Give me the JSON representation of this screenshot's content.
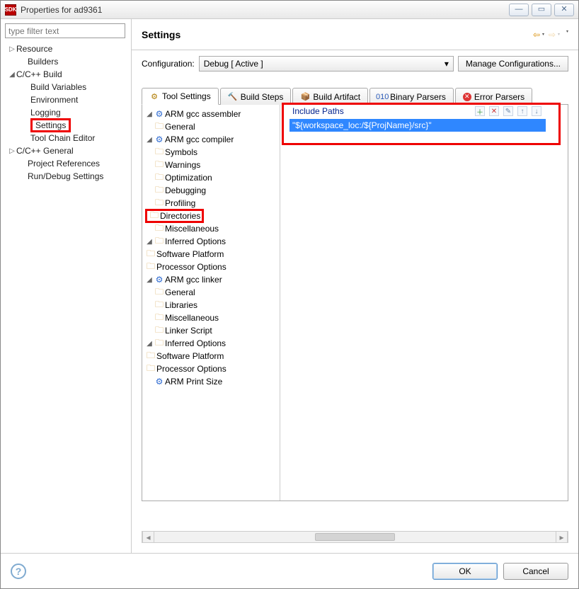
{
  "window": {
    "title": "Properties for ad9361"
  },
  "filter": {
    "placeholder": "type filter text"
  },
  "leftTree": {
    "resource": "Resource",
    "builders": "Builders",
    "ccbuild": "C/C++ Build",
    "buildvars": "Build Variables",
    "env": "Environment",
    "logging": "Logging",
    "settings": "Settings",
    "toolchain": "Tool Chain Editor",
    "ccgeneral": "C/C++ General",
    "projrefs": "Project References",
    "rundebug": "Run/Debug Settings"
  },
  "header": {
    "title": "Settings"
  },
  "config": {
    "label": "Configuration:",
    "value": "Debug  [ Active ]",
    "manage": "Manage Configurations..."
  },
  "tabs": {
    "toolsettings": "Tool Settings",
    "buildsteps": "Build Steps",
    "buildartifact": "Build Artifact",
    "binaryparsers": "Binary Parsers",
    "errorparsers": "Error Parsers"
  },
  "toolTree": {
    "asm": "ARM gcc assembler",
    "general": "General",
    "compiler": "ARM gcc compiler",
    "symbols": "Symbols",
    "warnings": "Warnings",
    "optimization": "Optimization",
    "debugging": "Debugging",
    "profiling": "Profiling",
    "directories": "Directories",
    "misc": "Miscellaneous",
    "inferred": "Inferred Options",
    "sw": "Software Platform",
    "proc": "Processor Options",
    "linker": "ARM gcc linker",
    "libraries": "Libraries",
    "linkerscript": "Linker Script",
    "printsize": "ARM Print Size"
  },
  "detail": {
    "includeLabel": "Include Paths",
    "path": "\"${workspace_loc:/${ProjName}/src}\""
  },
  "footer": {
    "ok": "OK",
    "cancel": "Cancel"
  }
}
